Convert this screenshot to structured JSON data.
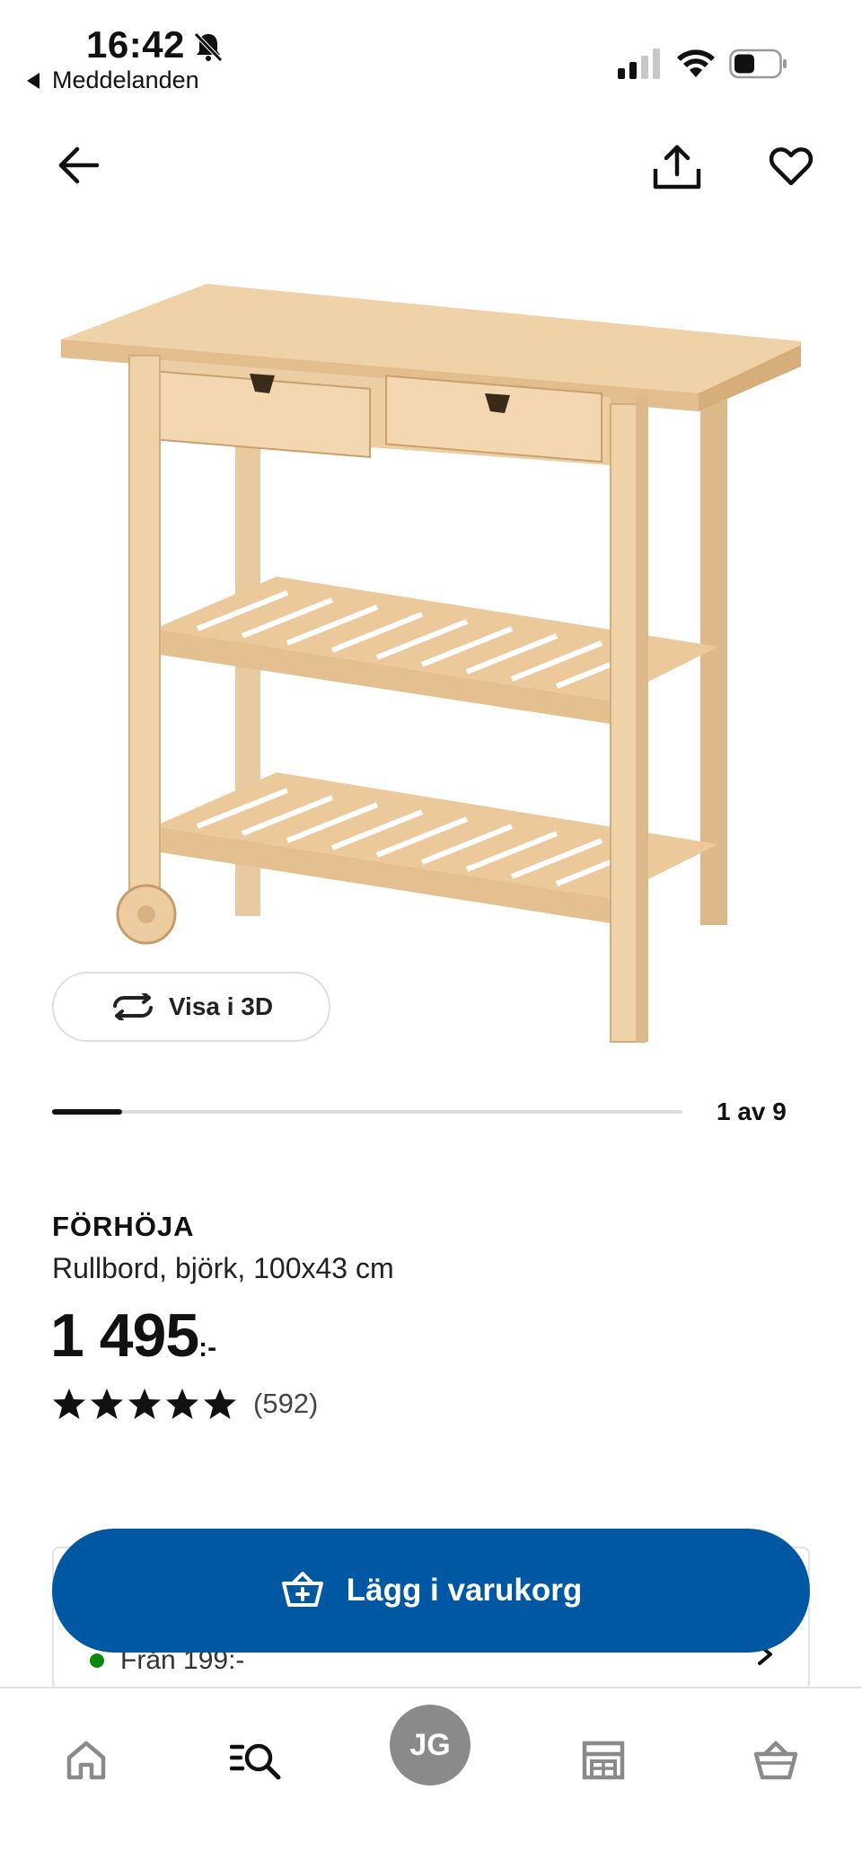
{
  "status_bar": {
    "time": "16:42",
    "back_app": "Meddelanden"
  },
  "gallery": {
    "view_3d_label": "Visa i 3D",
    "page_indicator": "1 av 9",
    "progress_fraction": 0.111
  },
  "product": {
    "name": "FÖRHÖJA",
    "description": "Rullbord, björk, 100x43 cm",
    "price": "1 495",
    "price_suffix": ":-",
    "rating_stars": 5,
    "review_count": "(592)"
  },
  "delivery": {
    "text": "Från 199:-"
  },
  "cta": {
    "add_to_cart": "Lägg i varukorg",
    "color": "#0058a3"
  },
  "bottom_nav": {
    "profile_initials": "JG",
    "items": [
      "home-icon",
      "search-icon",
      "profile",
      "store-icon",
      "cart-icon"
    ]
  }
}
